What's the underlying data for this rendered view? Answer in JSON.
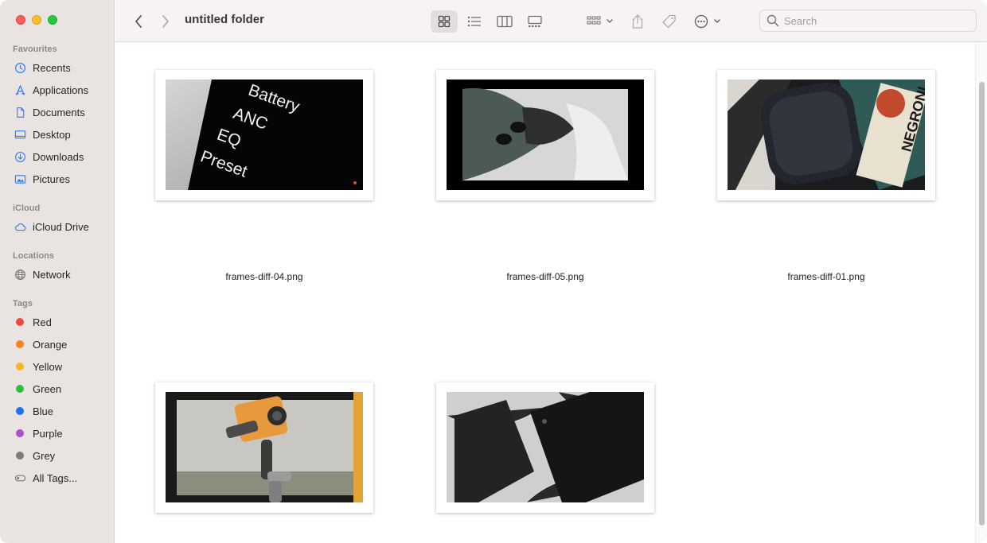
{
  "window": {
    "title": "untitled folder"
  },
  "sidebar": {
    "favourites_label": "Favourites",
    "favourites": [
      {
        "label": "Recents",
        "icon": "clock-icon"
      },
      {
        "label": "Applications",
        "icon": "applications-icon"
      },
      {
        "label": "Documents",
        "icon": "document-icon"
      },
      {
        "label": "Desktop",
        "icon": "desktop-icon"
      },
      {
        "label": "Downloads",
        "icon": "download-icon"
      },
      {
        "label": "Pictures",
        "icon": "pictures-icon"
      }
    ],
    "icloud_label": "iCloud",
    "icloud": [
      {
        "label": "iCloud Drive",
        "icon": "cloud-icon"
      }
    ],
    "locations_label": "Locations",
    "locations": [
      {
        "label": "Network",
        "icon": "globe-icon"
      }
    ],
    "tags_label": "Tags",
    "tags": [
      {
        "label": "Red",
        "color": "#f2463f"
      },
      {
        "label": "Orange",
        "color": "#f5841f"
      },
      {
        "label": "Yellow",
        "color": "#f4b921"
      },
      {
        "label": "Green",
        "color": "#2ebd3c"
      },
      {
        "label": "Blue",
        "color": "#1e6ff2"
      },
      {
        "label": "Purple",
        "color": "#a94fcf"
      },
      {
        "label": "Grey",
        "color": "#7c7c7c"
      },
      {
        "label": "All Tags...",
        "icon": "all-tags-icon"
      }
    ]
  },
  "toolbar": {
    "search_placeholder": "Search",
    "selected_view": "icon-view"
  },
  "files": [
    {
      "name": "frames-diff-04.png",
      "thumb_text": [
        "Battery",
        "ANC",
        "EQ",
        "Preset"
      ]
    },
    {
      "name": "frames-diff-05.png"
    },
    {
      "name": "frames-diff-01.png",
      "thumb_text": [
        "NEGRONI"
      ]
    },
    {
      "name": ""
    },
    {
      "name": ""
    }
  ]
}
